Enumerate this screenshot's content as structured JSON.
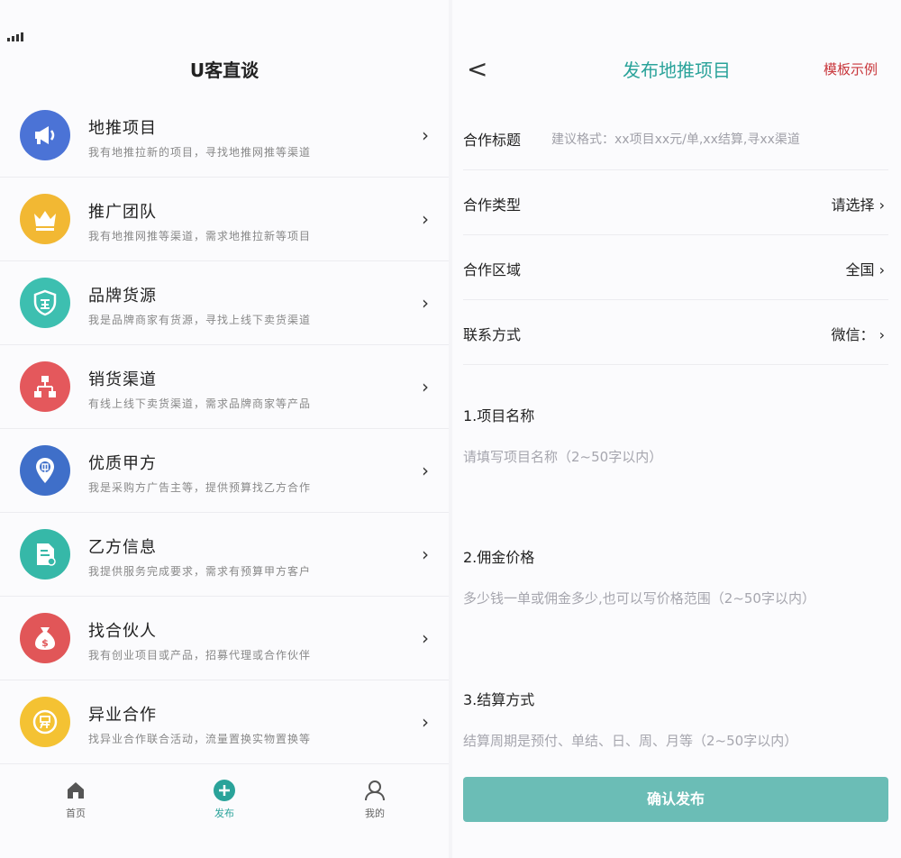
{
  "left": {
    "title": "U客直谈",
    "items": [
      {
        "title": "地推项目",
        "desc": "我有地推拉新的项目，寻找地推网推等渠道",
        "color": "#4b73d6",
        "icon": "megaphone-icon"
      },
      {
        "title": "推广团队",
        "desc": "我有地推网推等渠道，需求地推拉新等项目",
        "color": "#f2b833",
        "icon": "crown-icon"
      },
      {
        "title": "品牌货源",
        "desc": "我是品牌商家有货源，寻找上线下卖货渠道",
        "color": "#3dbfb0",
        "icon": "shield-icon"
      },
      {
        "title": "销货渠道",
        "desc": "有线上线下卖货渠道，需求品牌商家等产品",
        "color": "#e4585c",
        "icon": "network-icon"
      },
      {
        "title": "优质甲方",
        "desc": "我是采购方广告主等，提供预算找乙方合作",
        "color": "#3f6fc9",
        "icon": "location-pin-icon"
      },
      {
        "title": "乙方信息",
        "desc": "我提供服务完成要求，需求有预算甲方客户",
        "color": "#36b8a8",
        "icon": "document-icon"
      },
      {
        "title": "找合伙人",
        "desc": "我有创业项目或产品，招募代理或合作伙伴",
        "color": "#e15658",
        "icon": "money-bag-icon"
      },
      {
        "title": "异业合作",
        "desc": "找异业合作联合活动，流量置换实物置换等",
        "color": "#f4c233",
        "icon": "coin-icon"
      }
    ],
    "tabs": {
      "home": "首页",
      "publish": "发布",
      "mine": "我的"
    },
    "colors": {
      "tab_active": "#2aa39a"
    }
  },
  "right": {
    "back": "<",
    "title": "发布地推项目",
    "template_link": "模板示例",
    "rows": [
      {
        "label": "合作标题",
        "placeholder": "建议格式：xx项目xx元/单,xx结算,寻xx渠道"
      },
      {
        "label": "合作类型",
        "value": "请选择 ›"
      },
      {
        "label": "合作区域",
        "value": "全国 ›"
      },
      {
        "label": "联系方式",
        "value": "微信： ›"
      }
    ],
    "sections": [
      {
        "title": "1.项目名称",
        "placeholder": "请填写项目名称（2~50字以内）"
      },
      {
        "title": "2.佣金价格",
        "placeholder": "多少钱一单或佣金多少,也可以写价格范围（2~50字以内）"
      },
      {
        "title": "3.结算方式",
        "placeholder": "结算周期是预付、单结、日、周、月等（2~50字以内）"
      }
    ],
    "submit": "确认发布",
    "colors": {
      "accent": "#2aa39a",
      "link": "#c8363b",
      "button": "#6bbdb6"
    }
  }
}
